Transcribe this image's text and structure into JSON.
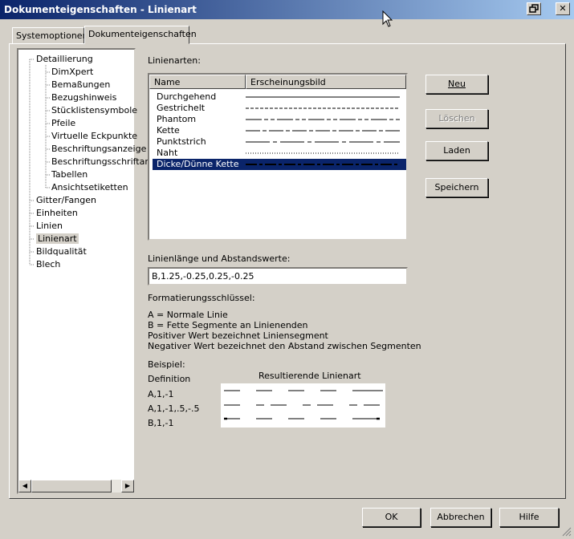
{
  "window": {
    "title": "Dokumenteigenschaften - Linienart",
    "tabs": [
      "Systemoptionen",
      "Dokumenteigenschaften"
    ]
  },
  "tree": {
    "items": [
      {
        "label": "Detaillierung",
        "level": 0
      },
      {
        "label": "DimXpert",
        "level": 1
      },
      {
        "label": "Bemaßungen",
        "level": 1
      },
      {
        "label": "Bezugshinweis",
        "level": 1
      },
      {
        "label": "Stücklistensymbole",
        "level": 1
      },
      {
        "label": "Pfeile",
        "level": 1
      },
      {
        "label": "Virtuelle Eckpunkte",
        "level": 1
      },
      {
        "label": "Beschriftungsanzeige",
        "level": 1
      },
      {
        "label": "Beschriftungsschriftart",
        "level": 1
      },
      {
        "label": "Tabellen",
        "level": 1
      },
      {
        "label": "Ansichtsetiketten",
        "level": 1
      },
      {
        "label": "Gitter/Fangen",
        "level": 0
      },
      {
        "label": "Einheiten",
        "level": 0
      },
      {
        "label": "Linien",
        "level": 0
      },
      {
        "label": "Linienart",
        "level": 0,
        "selected": true
      },
      {
        "label": "Bildqualität",
        "level": 0
      },
      {
        "label": "Blech",
        "level": 0
      }
    ]
  },
  "linetypes": {
    "section_label": "Linienarten:",
    "columns": [
      "Name",
      "Erscheinungsbild"
    ],
    "rows": [
      {
        "name": "Durchgehend",
        "pattern": "solid"
      },
      {
        "name": "Gestrichelt",
        "pattern": "dashed"
      },
      {
        "name": "Phantom",
        "pattern": "phantom"
      },
      {
        "name": "Kette",
        "pattern": "chain"
      },
      {
        "name": "Punktstrich",
        "pattern": "centerline"
      },
      {
        "name": "Naht",
        "pattern": "dotted"
      },
      {
        "name": "Dicke/Dünne Kette",
        "pattern": "thickchain",
        "selected": true
      }
    ]
  },
  "buttons": {
    "new": "Neu",
    "delete": "Löschen",
    "load": "Laden",
    "save": "Speichern"
  },
  "length": {
    "label": "Linienlänge und Abstandswerte:",
    "value": "B,1.25,-0.25,0.25,-0.25"
  },
  "format": {
    "label": "Formatierungsschlüssel:",
    "lines": [
      "A = Normale Linie",
      "B = Fette Segmente an Linienenden",
      "Positiver Wert bezeichnet Liniensegment",
      "Negativer Wert bezeichnet den Abstand zwischen Segmenten"
    ]
  },
  "example": {
    "label": "Beispiel:",
    "definition_header": "Definition",
    "result_header": "Resultierende Linienart",
    "definitions": [
      "A,1,-1",
      "A,1,-1,.5,-.5",
      "B,1,-1"
    ]
  },
  "footer": {
    "ok": "OK",
    "cancel": "Abbrechen",
    "help": "Hilfe"
  },
  "colors": {
    "selection": "#0a246a",
    "face": "#d4d0c8"
  }
}
